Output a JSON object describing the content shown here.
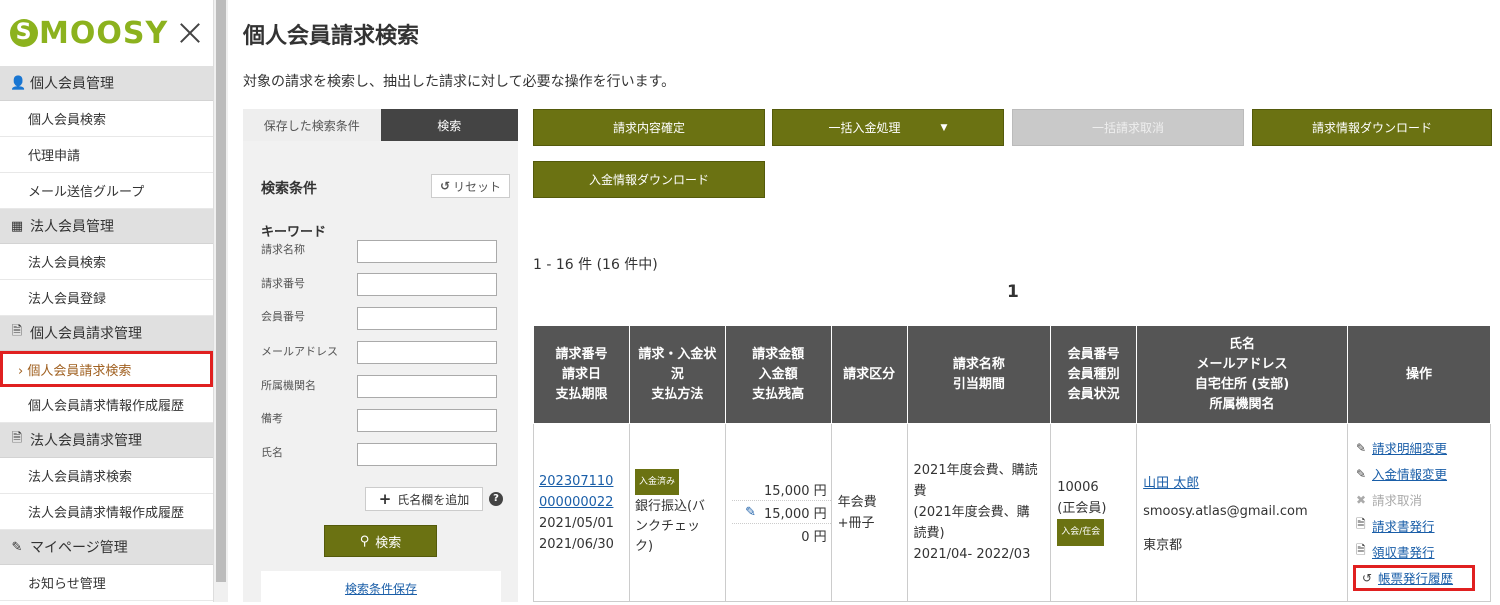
{
  "brand": {
    "logo_s": "S",
    "logo_rest": "MOOSY"
  },
  "sidebar": {
    "sections": [
      {
        "title": "個人会員管理",
        "icon": "person-icon",
        "items": [
          {
            "label": "個人会員検索",
            "active": false
          },
          {
            "label": "代理申請",
            "active": false
          },
          {
            "label": "メール送信グループ",
            "active": false
          }
        ]
      },
      {
        "title": "法人会員管理",
        "icon": "building-icon",
        "items": [
          {
            "label": "法人会員検索",
            "active": false
          },
          {
            "label": "法人会員登録",
            "active": false
          }
        ]
      },
      {
        "title": "個人会員請求管理",
        "icon": "document-icon",
        "items": [
          {
            "label": "› 個人会員請求検索",
            "active": true
          },
          {
            "label": "個人会員請求情報作成履歴",
            "active": false
          }
        ]
      },
      {
        "title": "法人会員請求管理",
        "icon": "document-icon",
        "items": [
          {
            "label": "法人会員請求検索",
            "active": false
          },
          {
            "label": "法人会員請求情報作成履歴",
            "active": false
          }
        ]
      },
      {
        "title": "マイページ管理",
        "icon": "pen-icon",
        "items": [
          {
            "label": "お知らせ管理",
            "active": false
          }
        ]
      }
    ]
  },
  "page": {
    "title": "個人会員請求検索",
    "description": "対象の請求を検索し、抽出した請求に対して必要な操作を行います。"
  },
  "search": {
    "tabs": [
      {
        "label": "保存した検索条件",
        "active": false
      },
      {
        "label": "検索",
        "active": true
      }
    ],
    "title": "検索条件",
    "reset_label": "リセット",
    "keyword_label": "キーワード",
    "fields": [
      "請求名称",
      "請求番号",
      "会員番号",
      "メールアドレス",
      "所属機関名",
      "備考",
      "氏名"
    ],
    "add_name_label": "氏名欄を追加",
    "help_label": "?",
    "search_label": "検索",
    "save_label": "検索条件保存"
  },
  "actions": {
    "confirm": "請求内容確定",
    "bulk_payment": "一括入金処理",
    "bulk_cancel": "一括請求取消",
    "download_invoice": "請求情報ダウンロード",
    "download_payment": "入金情報ダウンロード"
  },
  "results": {
    "count_text": "1 - 16 件 (16 件中)",
    "page": "1",
    "headers": [
      [
        "請求番号",
        "請求日",
        "支払期限"
      ],
      [
        "請求・入金状",
        "況",
        "支払方法"
      ],
      [
        "請求金額",
        "入金額",
        "支払残高"
      ],
      [
        "請求区分"
      ],
      [
        "請求名称",
        "引当期間"
      ],
      [
        "会員番号",
        "会員種別",
        "会員状況"
      ],
      [
        "氏名",
        "メールアドレス",
        "自宅住所 (支部)",
        "所属機関名"
      ],
      [
        "操作"
      ]
    ],
    "rows": [
      {
        "invoice_no_1": "202307110",
        "invoice_no_2": "000000022",
        "invoice_date": "2021/05/01",
        "due_date": "2021/06/30",
        "status_badge": "入金済み",
        "method_1": "銀行振込(バ",
        "method_2": "ンクチェッ",
        "method_3": "ク)",
        "amount": "15,000 円",
        "paid": "15,000 円",
        "balance": "0 円",
        "category_1": "年会費",
        "category_2": "+冊子",
        "name_1": "2021年度会費、購読",
        "name_2": "費",
        "name_3": "(2021年度会費、購",
        "name_4": "読費)",
        "period": "2021/04- 2022/03",
        "member_no": "10006",
        "member_type": "(正会員)",
        "member_status": "入会/在会",
        "person_name": "山田 太郎",
        "email": "smoosy.atlas@gmail.com",
        "address": "東京都",
        "ops": [
          {
            "label": "請求明細変更",
            "icon": "pencil-icon",
            "enabled": true
          },
          {
            "label": "入金情報変更",
            "icon": "pencil-icon",
            "enabled": true
          },
          {
            "label": "請求取消",
            "icon": "cross-icon",
            "enabled": false
          },
          {
            "label": "請求書発行",
            "icon": "document-icon",
            "enabled": true
          },
          {
            "label": "領収書発行",
            "icon": "document-icon",
            "enabled": true
          },
          {
            "label": "帳票発行履歴",
            "icon": "history-icon",
            "enabled": true
          }
        ]
      }
    ]
  },
  "colors": {
    "accent": "#6b7212",
    "brand": "#8cb21e",
    "highlight": "#e02020",
    "header": "#555555"
  }
}
